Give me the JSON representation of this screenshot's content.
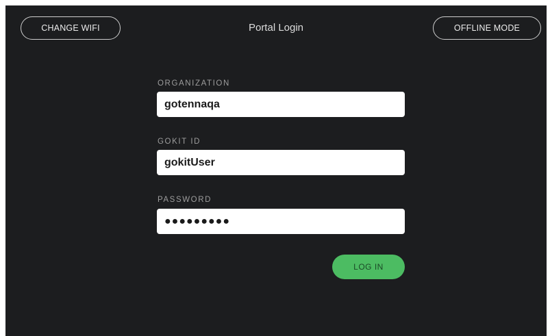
{
  "header": {
    "change_wifi_label": "CHANGE WIFI",
    "title": "Portal Login",
    "offline_mode_label": "OFFLINE MODE"
  },
  "form": {
    "organization": {
      "label": "ORGANIZATION",
      "value": "gotennaqa"
    },
    "gokit_id": {
      "label": "GOKIT ID",
      "value": "gokitUser"
    },
    "password": {
      "label": "PASSWORD",
      "masked_value": "●●●●●●●●●"
    },
    "login_label": "LOG IN"
  },
  "colors": {
    "background": "#1c1d1f",
    "accent_green": "#4cbc62",
    "label_gray": "#9d9d9d"
  }
}
